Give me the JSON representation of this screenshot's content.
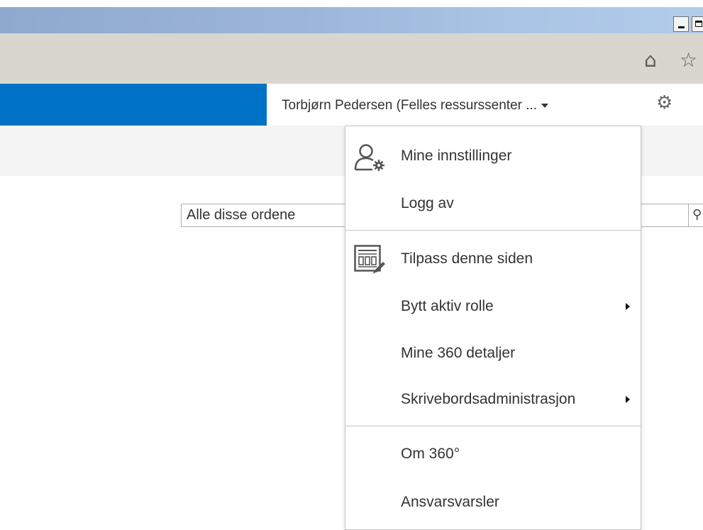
{
  "window": {
    "minimize_glyph": "minimize-icon",
    "maximize_glyph": "maximize-icon"
  },
  "browser": {
    "icons": [
      "home-icon",
      "favorites-star-icon"
    ]
  },
  "suite": {
    "brand_color": "#0072c6",
    "user_name": "Torbjørn Pedersen (Felles ressurssenter ...",
    "settings_icon": "gear-icon"
  },
  "search": {
    "value": "Alle disse ordene"
  },
  "menu": {
    "items": [
      {
        "label": "Mine innstillinger",
        "icon": "user-settings-icon"
      },
      {
        "label": "Logg av"
      },
      {
        "label": "Tilpass denne siden",
        "icon": "customize-page-icon"
      },
      {
        "label": "Bytt aktiv rolle",
        "submenu": true
      },
      {
        "label": "Mine 360 detaljer"
      },
      {
        "label": "Skrivebordsadministrasjon",
        "submenu": true
      },
      {
        "label": "Om 360°"
      },
      {
        "label": "Ansvarsvarsler"
      }
    ]
  }
}
